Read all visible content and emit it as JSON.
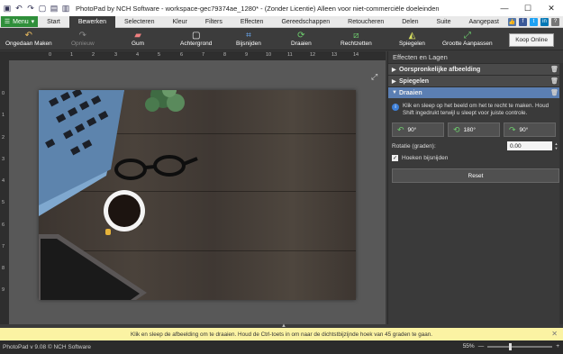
{
  "window": {
    "title": "PhotoPad by NCH Software - workspace-gec79374ae_1280* - (Zonder Licentie) Alleen voor niet-commerciële doeleinden",
    "minimize": "—",
    "maximize": "☐",
    "close": "✕"
  },
  "menu": {
    "menu_label": "Menu",
    "tabs": [
      "Start",
      "Bewerken",
      "Selecteren",
      "Kleur",
      "Filters",
      "Effecten",
      "Gereedschappen",
      "Retoucheren",
      "Delen",
      "Suite",
      "Aangepast"
    ],
    "active_tab": "Bewerken"
  },
  "toolbar": {
    "undo": "Ongedaan Maken",
    "redo": "Opnieuw",
    "eraser": "Gum",
    "background": "Achtergrond",
    "crop": "Bijsnijden",
    "rotate": "Draaien",
    "straighten": "Rechtzetten",
    "mirror": "Spiegelen",
    "resize": "Grootte Aanpassen",
    "buy": "Koop Online"
  },
  "ruler": {
    "top": [
      "0",
      "1",
      "2",
      "3",
      "4",
      "5",
      "6",
      "7",
      "8",
      "9",
      "10",
      "11",
      "12",
      "13",
      "14"
    ],
    "left": [
      "0",
      "1",
      "2",
      "3",
      "4",
      "5",
      "6",
      "7",
      "8",
      "9"
    ]
  },
  "panel": {
    "title": "Effecten en Lagen",
    "sections": [
      "Oorspronkelijke afbeelding",
      "Spiegelen",
      "Draaien"
    ],
    "active_section": "Draaien",
    "hint": "Klik en sleep op het beeld om het te recht te maken. Houd Shift ingedrukt terwijl u sleept voor juiste controle.",
    "rotate_buttons": [
      "90°",
      "180°",
      "90°"
    ],
    "rotation_label": "Rotatie (graden):",
    "rotation_value": "0.00",
    "crop_corners_label": "Hoeken bijsnijden",
    "crop_corners_checked": true,
    "reset_label": "Reset"
  },
  "notice": {
    "text": "Klik en sleep de afbeelding om te draaien. Houd de Ctrl-toets in om naar de dichtstbijzijnde hoek van 45 graden te gaan."
  },
  "status": {
    "version": "PhotoPad v 9.08 © NCH Software",
    "zoom": "55%",
    "zoom_fraction": 0.35
  },
  "colors": {
    "accent_green": "#2f8f3a",
    "active_section": "#5b7fb3",
    "notice_bg": "#fbf3a3"
  }
}
